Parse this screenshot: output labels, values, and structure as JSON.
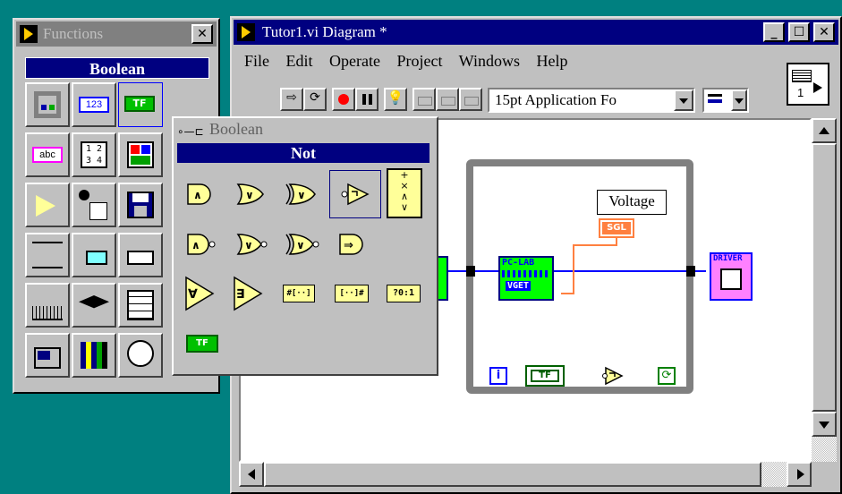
{
  "functions_palette": {
    "title": "Functions",
    "close_label": "✕",
    "header": "Boolean",
    "tiles": [
      {
        "icon": "numeric-icon",
        "text": "123"
      },
      {
        "icon": "boolean-tf-icon",
        "text": "TF"
      },
      {
        "icon": "string-icon",
        "text": "abc"
      },
      {
        "icon": "array-icon",
        "text": "1 2 3 4"
      }
    ]
  },
  "boolean_subpalette": {
    "title": "Boolean",
    "header": "Not",
    "row3_labels": [
      "#[··]",
      "[··]#",
      "?0:1"
    ],
    "tf_label": "TF"
  },
  "diagram_window": {
    "title": "Tutor1.vi Diagram *",
    "menu": [
      "File",
      "Edit",
      "Operate",
      "Project",
      "Windows",
      "Help"
    ],
    "font_selector": "15pt Application Fo",
    "connector_label": "1",
    "voltage_label": "Voltage",
    "sgl_label": "SGL",
    "pclab_label": "PC-LAB",
    "vget_label": "VGET",
    "driver_label": "DRIVER",
    "iteration_label": "i",
    "tf_constant_label": "TF"
  },
  "colors": {
    "desktop": "#008080",
    "title_active": "#000080",
    "title_inactive": "#808080",
    "wire_blue": "#0000ff",
    "wire_orange": "#ff8040",
    "subvi_green": "#00ff00",
    "subvi_magenta": "#ff80ff"
  }
}
